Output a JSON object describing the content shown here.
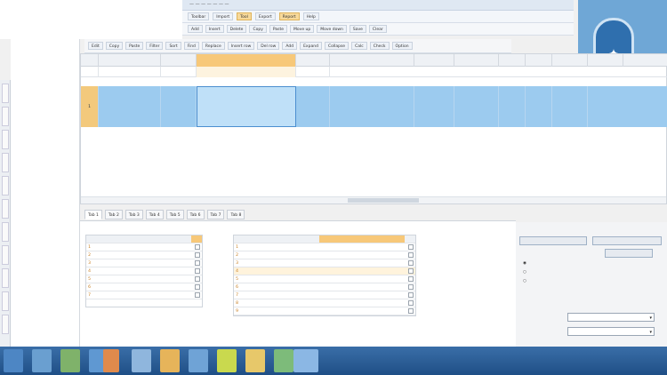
{
  "window": {
    "title": "—  —  —  —  —  —  —"
  },
  "ribbon": {
    "row1": [
      "Toolbar",
      "Import",
      "Tool",
      "Export",
      "Report",
      "Help"
    ],
    "row2": [
      "Add",
      "Insert",
      "Delete",
      "Copy",
      "Paste",
      "Move up",
      "Move down",
      "Save",
      "Clear"
    ],
    "row3": [
      "Edit",
      "Copy",
      "Paste",
      "Filter",
      "Sort",
      "Find",
      "Replace",
      "Insert row",
      "Del row",
      "Add",
      "Expand",
      "Collapse",
      "Calc",
      "Check",
      "Option"
    ]
  },
  "left_toolbar": [
    "",
    "",
    "",
    "",
    "",
    "",
    "",
    "",
    "",
    "",
    ""
  ],
  "grid": {
    "headers": [
      "",
      "",
      "",
      "",
      "",
      "",
      "",
      "",
      "",
      "",
      "",
      "",
      ""
    ],
    "row_index": "1",
    "row_cells": [
      "",
      "",
      "",
      "",
      "",
      "",
      "",
      "",
      "",
      "",
      ""
    ]
  },
  "tabs": [
    "Tab 1",
    "Tab 2",
    "Tab 3",
    "Tab 4",
    "Tab 5",
    "Tab 6",
    "Tab 7",
    "Tab 8"
  ],
  "left_table": {
    "title": "",
    "header": "",
    "rows": [
      "",
      "",
      "",
      "",
      "",
      "",
      ""
    ]
  },
  "mid_table": {
    "title": "",
    "header": "",
    "rows": [
      "",
      "",
      "",
      "",
      "",
      "",
      "",
      "",
      ""
    ]
  },
  "right_panel": {
    "title": "",
    "btn1": "",
    "btn2": "",
    "btn3": "",
    "radio1": "",
    "radio2": "",
    "radio3": "",
    "label1": "",
    "label2": "",
    "select1": "",
    "select2": ""
  },
  "colors": {
    "selected_row": "#9ccbef",
    "header_accent": "#f7c879",
    "taskbar": "#2a5d96"
  },
  "taskbar": {
    "icons": [
      "start-icon",
      "app-icon",
      "app-icon",
      "app-icon",
      "app-icon",
      "app-icon",
      "app-icon",
      "app-icon",
      "app-icon",
      "app-icon",
      "app-icon",
      "app-icon"
    ],
    "tray": ""
  }
}
